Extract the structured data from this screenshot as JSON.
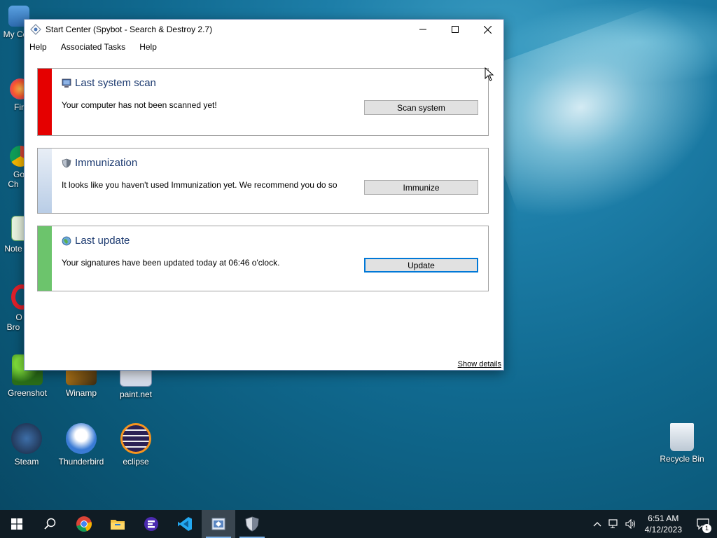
{
  "window": {
    "title": "Start Center (Spybot - Search & Destroy 2.7)",
    "menu": [
      "Help",
      "Associated Tasks",
      "Help"
    ],
    "show_details": "Show details"
  },
  "panels": [
    {
      "title": "Last system scan",
      "desc": "Your computer has not been scanned yet!",
      "button": "Scan system",
      "stripe_color": "#e50000",
      "icon": "monitor-icon"
    },
    {
      "title": "Immunization",
      "desc": "It looks like you haven't used Immunization yet. We recommend you do so",
      "button": "Immunize",
      "stripe_color": "#b9cde6",
      "icon": "shield-icon"
    },
    {
      "title": "Last update",
      "desc": "Your signatures have been updated today at 06:46 o'clock.",
      "button": "Update",
      "stripe_color": "#6cc46c",
      "icon": "globe-icon"
    }
  ],
  "desktop": {
    "icons": [
      {
        "label": "My Co",
        "icon": "computer-icon"
      },
      {
        "label": "Fir",
        "icon": "firefox-icon"
      },
      {
        "label": "Go\nCh",
        "icon": "chrome-icon"
      },
      {
        "label": "Note",
        "icon": "notepad-icon"
      },
      {
        "label": "O\nBro",
        "icon": "opera-icon"
      },
      {
        "label": "Greenshot",
        "icon": "greenshot-icon"
      },
      {
        "label": "Winamp",
        "icon": "winamp-icon"
      },
      {
        "label": "paint.net",
        "icon": "paintnet-icon"
      },
      {
        "label": "Steam",
        "icon": "steam-icon"
      },
      {
        "label": "Thunderbird",
        "icon": "thunderbird-icon"
      },
      {
        "label": "eclipse",
        "icon": "eclipse-icon"
      },
      {
        "label": "Recycle Bin",
        "icon": "recycle-bin-icon"
      }
    ]
  },
  "taskbar": {
    "time": "6:51 AM",
    "date": "4/12/2023",
    "notification_count": "1"
  }
}
